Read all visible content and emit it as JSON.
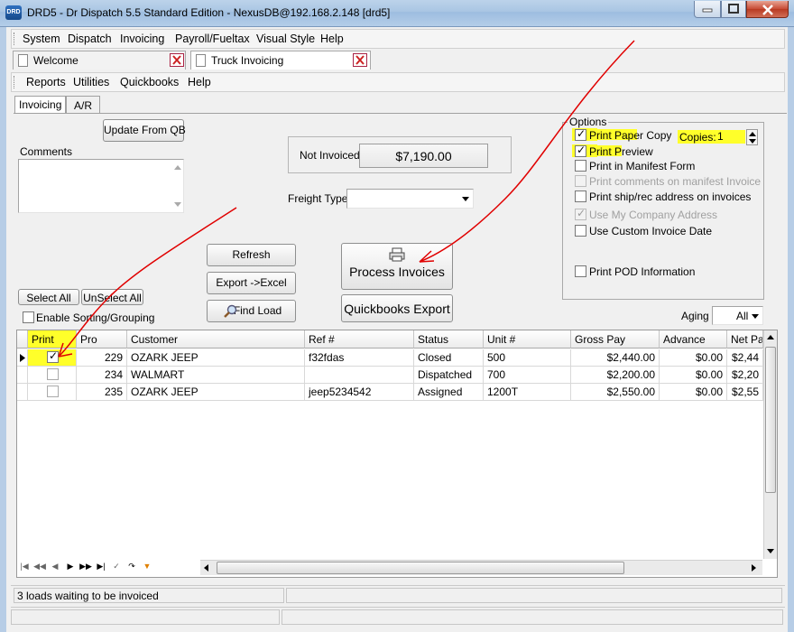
{
  "window": {
    "title": "DRD5 - Dr Dispatch 5.5 Standard Edition - NexusDB@192.168.2.148 [drd5]",
    "icon_label": "DRD"
  },
  "main_menu": [
    "System",
    "Dispatch",
    "Invoicing",
    "Payroll/Fueltax",
    "Visual Style",
    "Help"
  ],
  "doc_tabs": [
    "Welcome",
    "Truck Invoicing"
  ],
  "sub_menu": [
    "Reports",
    "Utilities",
    "Quickbooks",
    "Help"
  ],
  "inner_tabs": [
    "Invoicing",
    "A/R"
  ],
  "form": {
    "update_from_qb": "Update From QB",
    "comments_label": "Comments",
    "not_invoiced_label": "Not Invoiced",
    "not_invoiced_value": "$7,190.00",
    "freight_type_label": "Freight Type",
    "freight_type_value": "",
    "refresh": "Refresh",
    "export_excel": "Export ->Excel",
    "find_load": "Find Load",
    "process_invoices": "Process Invoices",
    "quickbooks_export": "Quickbooks Export",
    "select_all": "Select All",
    "unselect_all": "UnSelect All",
    "enable_sorting": "Enable Sorting/Grouping",
    "aging_label": "Aging",
    "aging_value": "All"
  },
  "options": {
    "title": "Options",
    "copies_label": "Copies:",
    "copies_value": "1",
    "items": [
      {
        "label": "Print Paper Copy",
        "checked": true,
        "enabled": true
      },
      {
        "label": "Print Preview",
        "checked": true,
        "enabled": true
      },
      {
        "label": "Print in Manifest Form",
        "checked": false,
        "enabled": true
      },
      {
        "label": "Print comments on manifest Invoice",
        "checked": false,
        "enabled": false
      },
      {
        "label": "Print ship/rec address on invoices",
        "checked": false,
        "enabled": true
      },
      {
        "label": "Use My Company Address",
        "checked": true,
        "enabled": false
      },
      {
        "label": "Use Custom Invoice Date",
        "checked": false,
        "enabled": true
      },
      {
        "label": "Print POD Information",
        "checked": false,
        "enabled": true
      }
    ]
  },
  "grid": {
    "columns": [
      "Print",
      "Pro",
      "Customer",
      "Ref #",
      "Status",
      "Unit #",
      "Gross Pay",
      "Advance",
      "Net Pay"
    ],
    "rows": [
      {
        "print": true,
        "pro": "229",
        "customer": "OZARK  JEEP",
        "ref": "f32fdas",
        "status": "Closed",
        "unit": "500",
        "gross": "$2,440.00",
        "advance": "$0.00",
        "net": "$2,44"
      },
      {
        "print": false,
        "pro": "234",
        "customer": "WALMART",
        "ref": "",
        "status": "Dispatched",
        "unit": "700",
        "gross": "$2,200.00",
        "advance": "$0.00",
        "net": "$2,20"
      },
      {
        "print": false,
        "pro": "235",
        "customer": "OZARK  JEEP",
        "ref": "jeep5234542",
        "status": "Assigned",
        "unit": "1200T",
        "gross": "$2,550.00",
        "advance": "$0.00",
        "net": "$2,55"
      }
    ]
  },
  "status": {
    "message": "3 loads waiting to be invoiced"
  },
  "colors": {
    "highlight": "#ffff2a",
    "annotation_arrow": "#e00000"
  }
}
